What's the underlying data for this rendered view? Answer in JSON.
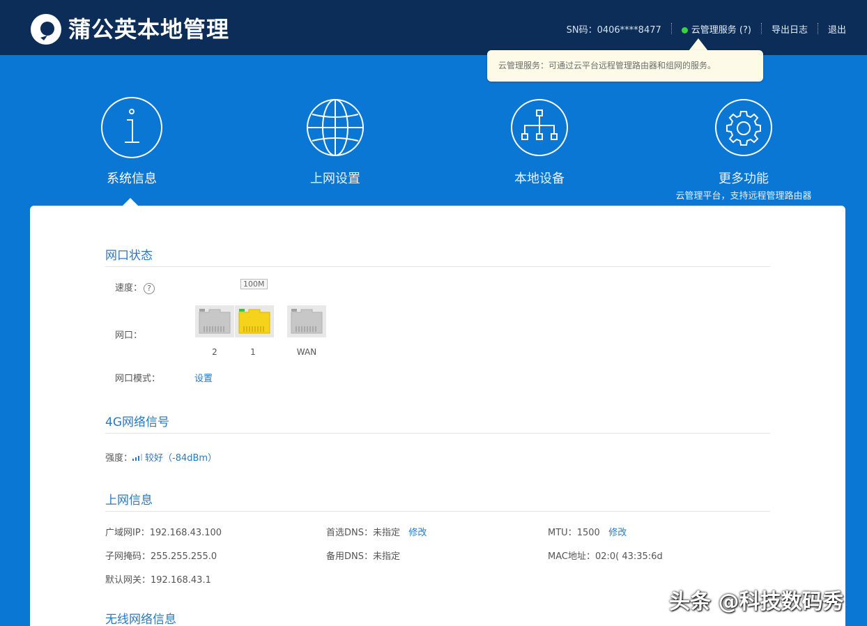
{
  "header": {
    "brand": "蒲公英本地管理",
    "sn_label": "SN码：0406****8477",
    "cloud_service": "云管理服务 (?)",
    "export_log": "导出日志",
    "logout": "退出",
    "status_color": "#3bd33b"
  },
  "tooltip": {
    "text": "云管理服务：可通过云平台远程管理路由器和组网的服务。"
  },
  "nav": {
    "items": [
      {
        "label": "系统信息",
        "icon": "info-icon"
      },
      {
        "label": "上网设置",
        "icon": "globe-icon"
      },
      {
        "label": "本地设备",
        "icon": "network-tree-icon"
      },
      {
        "label": "更多功能",
        "icon": "gear-icon"
      }
    ],
    "more_subtitle": "云管理平台，支持远程管理路由器"
  },
  "port_status": {
    "title": "网口状态",
    "speed_label": "速度：",
    "speed_help": "?",
    "speed_tag": "100M",
    "port_label": "网口：",
    "ports": [
      {
        "name": "2",
        "connected": false
      },
      {
        "name": "1",
        "connected": true
      },
      {
        "name": "WAN",
        "connected": false
      }
    ],
    "mode_label": "网口模式：",
    "mode_link": "设置"
  },
  "signal_4g": {
    "title": "4G网络信号",
    "strength_label": "强度：",
    "strength_value": "较好（-84dBm）"
  },
  "net_info": {
    "title": "上网信息",
    "wan_ip_label": "广域网IP：",
    "wan_ip": "192.168.43.100",
    "mask_label": "子网掩码：",
    "mask": "255.255.255.0",
    "gateway_label": "默认网关：",
    "gateway": "192.168.43.1",
    "dns1_label": "首选DNS：",
    "dns1": "未指定",
    "dns2_label": "备用DNS：",
    "dns2": "未指定",
    "modify": "修改",
    "mtu_label": "MTU：",
    "mtu": "1500",
    "mac_label": "MAC地址：",
    "mac": "02:0(     43:35:6d"
  },
  "wireless": {
    "title": "无线网络信息"
  },
  "watermark": "头条 @科技数码秀"
}
